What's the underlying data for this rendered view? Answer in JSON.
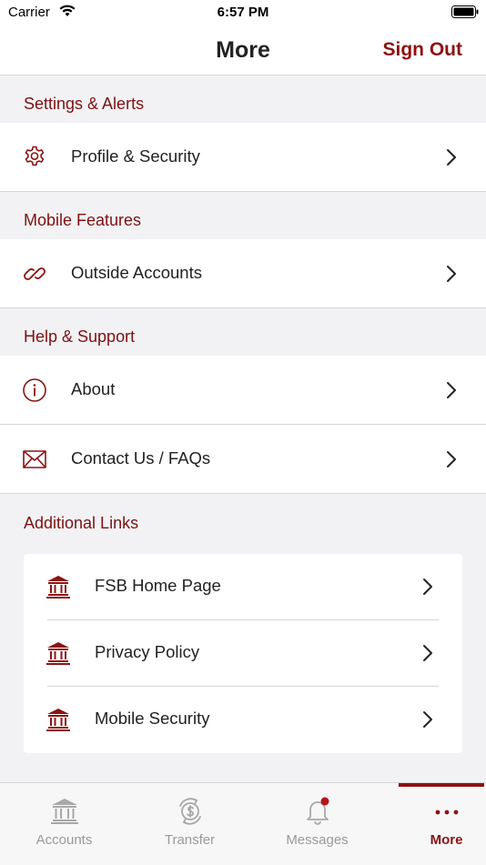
{
  "status_bar": {
    "carrier": "Carrier",
    "time": "6:57 PM"
  },
  "nav": {
    "title": "More",
    "sign_out": "Sign Out"
  },
  "sections": {
    "settings": {
      "header": "Settings & Alerts",
      "items": [
        {
          "label": "Profile & Security",
          "icon": "gear-icon"
        }
      ]
    },
    "mobile": {
      "header": "Mobile Features",
      "items": [
        {
          "label": "Outside Accounts",
          "icon": "link-icon"
        }
      ]
    },
    "help": {
      "header": "Help & Support",
      "items": [
        {
          "label": "About",
          "icon": "info-icon"
        },
        {
          "label": "Contact Us / FAQs",
          "icon": "envelope-icon"
        }
      ]
    },
    "links": {
      "header": "Additional Links",
      "items": [
        {
          "label": "FSB Home Page",
          "icon": "bank-icon"
        },
        {
          "label": "Privacy Policy",
          "icon": "bank-icon"
        },
        {
          "label": "Mobile Security",
          "icon": "bank-icon"
        }
      ]
    }
  },
  "tabs": [
    {
      "label": "Accounts",
      "icon": "bank-icon",
      "active": false
    },
    {
      "label": "Transfer",
      "icon": "transfer-dollar-icon",
      "active": false
    },
    {
      "label": "Messages",
      "icon": "bell-icon",
      "active": false,
      "badge": true
    },
    {
      "label": "More",
      "icon": "more-dots-icon",
      "active": true
    }
  ],
  "colors": {
    "accent": "#8b1313",
    "section_text": "#7d1212",
    "background": "#f2f2f4",
    "inactive_tab": "#9a9a9a"
  }
}
